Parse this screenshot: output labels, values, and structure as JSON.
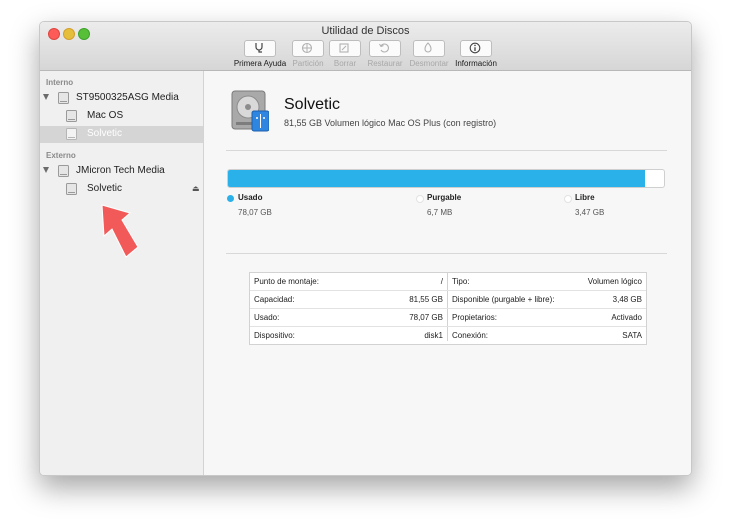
{
  "window": {
    "title": "Utilidad de Discos"
  },
  "toolbar": {
    "items": [
      {
        "label": "Primera Ayuda",
        "icon": "stethoscope-icon",
        "enabled": true
      },
      {
        "label": "Partición",
        "icon": "partition-icon",
        "enabled": false
      },
      {
        "label": "Borrar",
        "icon": "erase-icon",
        "enabled": false
      },
      {
        "label": "Restaurar",
        "icon": "restore-icon",
        "enabled": false
      },
      {
        "label": "Desmontar",
        "icon": "unmount-icon",
        "enabled": false
      },
      {
        "label": "Información",
        "icon": "info-icon",
        "enabled": true
      }
    ]
  },
  "sidebar": {
    "internal_label": "Interno",
    "external_label": "Externo",
    "internal_disk": "ST9500325ASG Media",
    "internal_volumes": [
      "Mac OS",
      "Solvetic"
    ],
    "external_disk": "JMicron Tech Media",
    "external_volumes": [
      "Solvetic"
    ],
    "selected": "Solvetic (Interno)"
  },
  "volume": {
    "name": "Solvetic",
    "description": "81,55 GB Volumen lógico Mac OS Plus (con registro)"
  },
  "usage": {
    "used_fraction": 0.957,
    "legend": [
      {
        "name": "Usado",
        "value": "78,07 GB",
        "color": "#2ab1ea"
      },
      {
        "name": "Purgable",
        "value": "6,7 MB",
        "color": "#ffffff"
      },
      {
        "name": "Libre",
        "value": "3,47 GB",
        "color": "#ffffff"
      }
    ]
  },
  "info": {
    "left": [
      {
        "label": "Punto de montaje:",
        "value": "/"
      },
      {
        "label": "Capacidad:",
        "value": "81,55 GB"
      },
      {
        "label": "Usado:",
        "value": "78,07 GB"
      },
      {
        "label": "Dispositivo:",
        "value": "disk1"
      }
    ],
    "right": [
      {
        "label": "Tipo:",
        "value": "Volumen lógico"
      },
      {
        "label": "Disponible (purgable + libre):",
        "value": "3,48 GB"
      },
      {
        "label": "Propietarios:",
        "value": "Activado"
      },
      {
        "label": "Conexión:",
        "value": "SATA"
      }
    ]
  },
  "colors": {
    "accent": "#2ab1ea",
    "arrow": "#f25a5a"
  }
}
